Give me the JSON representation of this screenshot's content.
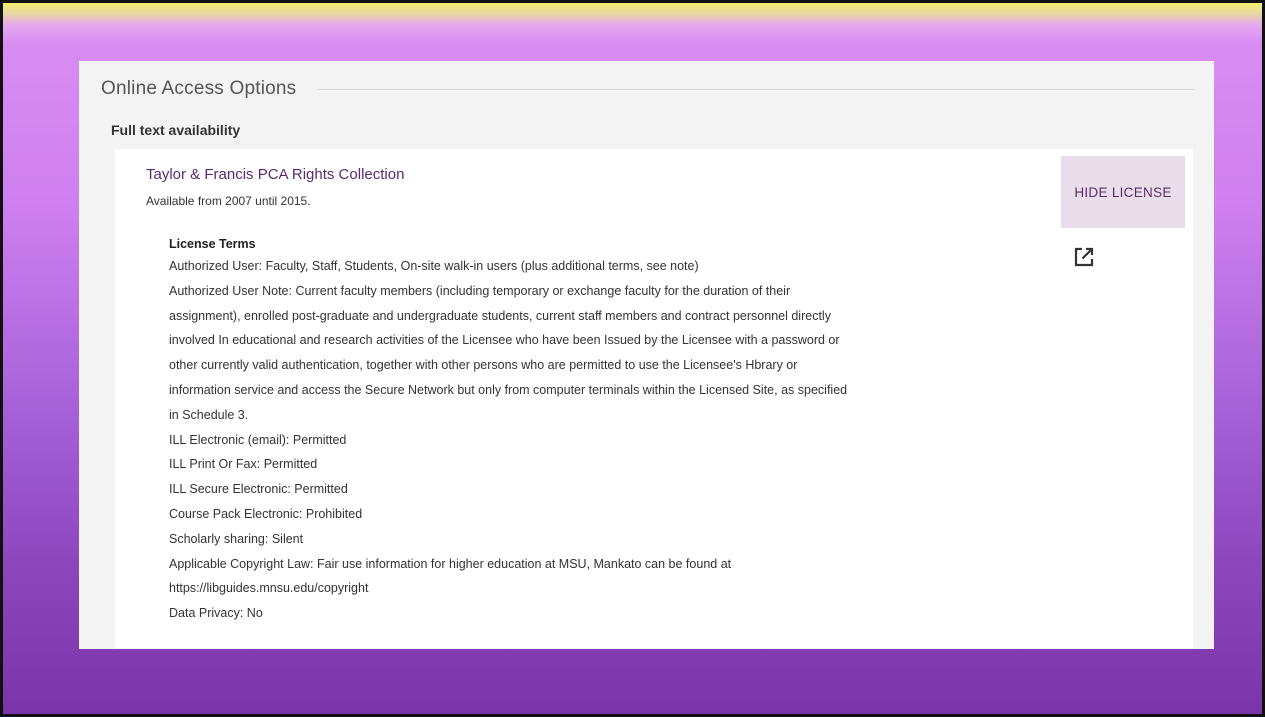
{
  "section": {
    "title": "Online Access Options",
    "subtitle": "Full text availability"
  },
  "service": {
    "provider": "Taylor & Francis PCA Rights Collection",
    "availability": "Available from 2007 until 2015.",
    "hide_license_label": "HIDE LICENSE",
    "external_link_icon": "external-link-icon"
  },
  "license": {
    "heading": "License Terms",
    "lines": [
      "Authorized User: Faculty, Staff, Students, On-site walk-in users (plus additional terms, see note)",
      "Authorized User Note: Current faculty members (including temporary or exchange faculty for the duration of their",
      "assignment), enrolled post-graduate and undergraduate students, current staff members and contract personnel directly",
      "involved In educational and research activities of the Licensee who have been Issued by the Licensee with a password or",
      "other currently valid authentication, together with other persons who are permitted to use the Licensee's Hbrary or",
      "information service and access the Secure Network but only from computer terminals within the Licensed Site, as specified",
      "in Schedule 3.",
      "ILL Electronic (email): Permitted",
      "ILL Print Or Fax: Permitted",
      "ILL Secure Electronic: Permitted",
      "Course Pack Electronic: Prohibited",
      "Scholarly sharing: Silent",
      "Applicable Copyright Law: Fair use information for higher education at MSU, Mankato can be found at",
      "https://libguides.mnsu.edu/copyright",
      "Data Privacy: No"
    ]
  },
  "colors": {
    "accent": "#5b2a6e",
    "button_bg": "#eaddea"
  }
}
